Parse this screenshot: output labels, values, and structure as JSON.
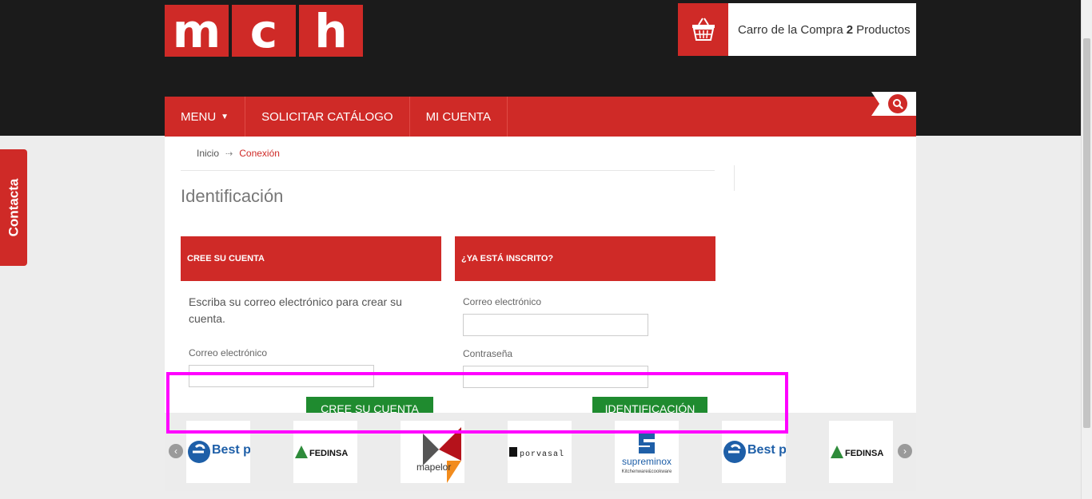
{
  "logo": {
    "letters": [
      "m",
      "c",
      "h"
    ]
  },
  "cart": {
    "label": "Carro de la Compra",
    "count": "2",
    "unit": "Productos",
    "icon": "basket-icon"
  },
  "nav": {
    "items": [
      {
        "label": "MENU",
        "has_caret": true
      },
      {
        "label": "SOLICITAR CATÁLOGO"
      },
      {
        "label": "MI CUENTA"
      }
    ],
    "search_icon": "search-icon"
  },
  "contact_tab": {
    "label": "Contacta"
  },
  "breadcrumb": {
    "home": "Inicio",
    "current": "Conexión"
  },
  "page_title": "Identificación",
  "create_account": {
    "heading": "CREE SU CUENTA",
    "description": "Escriba su correo electrónico para crear su cuenta.",
    "email_label": "Correo electrónico",
    "email_value": "",
    "button": "CREE SU CUENTA"
  },
  "login": {
    "heading": "¿YA ESTÁ INSCRITO?",
    "email_label": "Correo electrónico",
    "email_value": "",
    "password_label": "Contraseña",
    "password_value": "",
    "button": "IDENTIFICACIÓN"
  },
  "brands": [
    "Best products",
    "FEDINSA",
    "mapelor",
    "porvasal",
    "supreminox",
    "Best products",
    "FEDINSA"
  ],
  "brand_tagline": "Kitchenware&cookware",
  "colors": {
    "brand_red": "#cf2a27",
    "dark": "#1b1b1b",
    "button_green": "#1f8b2f",
    "highlight": "#ff00ff"
  }
}
